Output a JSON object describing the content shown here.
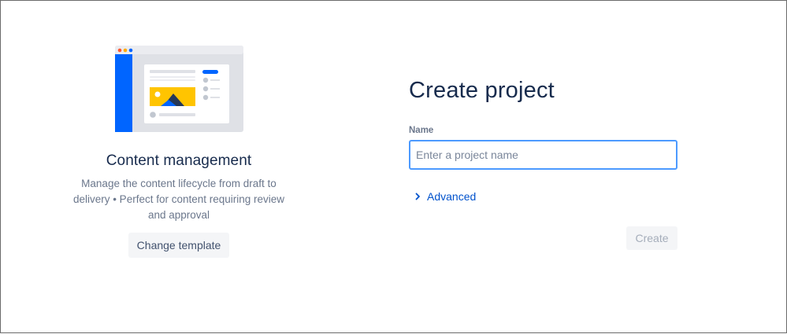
{
  "template": {
    "illustration_icon": "content-management-illustration",
    "title": "Content management",
    "description": "Manage the content lifecycle from draft to delivery • Perfect for content requiring review and approval",
    "change_button_label": "Change template"
  },
  "form": {
    "title": "Create project",
    "name_label": "Name",
    "name_value": "",
    "name_placeholder": "Enter a project name",
    "advanced_label": "Advanced",
    "advanced_icon": "chevron-right-icon",
    "create_button_label": "Create"
  },
  "colors": {
    "accent": "#0065ff",
    "focus_border": "#4c9aff",
    "link": "#0052cc",
    "heading": "#172b4d",
    "muted_text": "#6b778c",
    "button_bg": "#f4f5f7",
    "illustration_yellow": "#ffc400",
    "illustration_navy": "#253858"
  }
}
